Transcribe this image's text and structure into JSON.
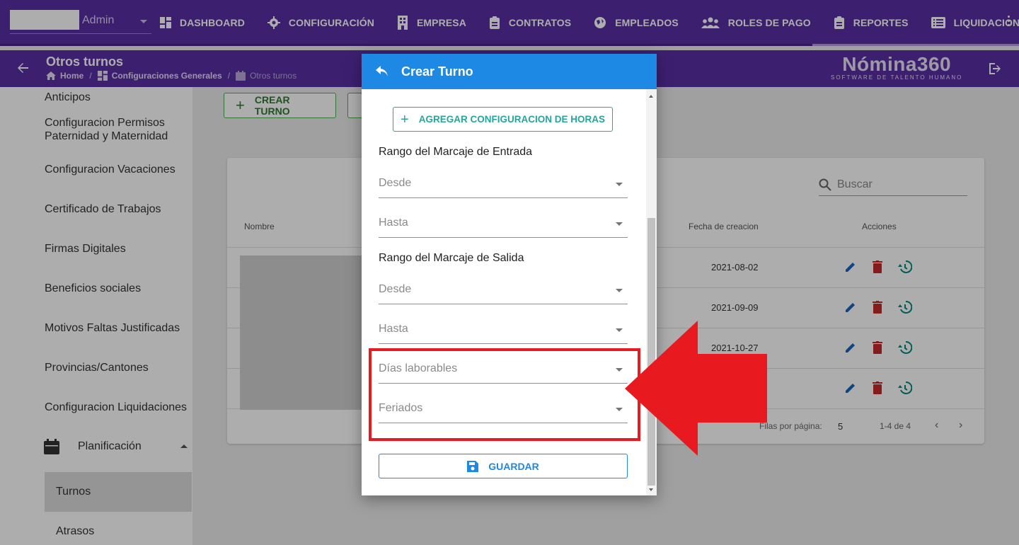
{
  "topnav": {
    "user_name": "Admin",
    "items": [
      {
        "label": "DASHBOARD",
        "icon": "dashboard-icon"
      },
      {
        "label": "CONFIGURACIÓN",
        "icon": "gear-icon"
      },
      {
        "label": "EMPRESA",
        "icon": "building-icon"
      },
      {
        "label": "CONTRATOS",
        "icon": "clipboard-icon"
      },
      {
        "label": "EMPLEADOS",
        "icon": "globe-icon"
      },
      {
        "label": "ROLES DE PAGO",
        "icon": "people-icon"
      },
      {
        "label": "REPORTES",
        "icon": "clipboard-icon"
      },
      {
        "label": "LIQUIDACIONES",
        "icon": "list-icon"
      }
    ]
  },
  "subheader": {
    "title": "Otros turnos",
    "breadcrumb": [
      "Home",
      "Configuraciones Generales",
      "Otros turnos"
    ],
    "brand_name": "Nómina360",
    "brand_tagline": "SOFTWARE DE TALENTO HUMANO"
  },
  "sidebar": {
    "items": [
      "Anticipos",
      "Configuracion Permisos Paternidad y Maternidad",
      "Configuracion Vacaciones",
      "Certificado de Trabajos",
      "Firmas Digitales",
      "Beneficios sociales",
      "Motivos Faltas Justificadas",
      "Provincias/Cantones",
      "Configuracion Liquidaciones"
    ],
    "group_label": "Planificación",
    "sub_items": [
      "Turnos",
      "Atrasos"
    ]
  },
  "toolbar": {
    "create_label": "CREAR TURNO"
  },
  "table": {
    "search_placeholder": "Buscar",
    "headers": {
      "name": "Nombre",
      "created": "Fecha de creacion",
      "actions": "Acciones"
    },
    "rows": [
      {
        "created": "2021-08-02"
      },
      {
        "created": "2021-09-09"
      },
      {
        "created": "2021-10-27"
      },
      {
        "created": ""
      }
    ],
    "rows_per_page_label": "Filas por página:",
    "rows_per_page": "5",
    "range": "1-4 de 4"
  },
  "dialog": {
    "title": "Crear Turno",
    "add_hours_label": "AGREGAR CONFIGURACION DE HORAS",
    "entry_range_label": "Rango del Marcaje de Entrada",
    "exit_range_label": "Rango del Marcaje de Salida",
    "from_placeholder": "Desde",
    "to_placeholder": "Hasta",
    "workdays_placeholder": "Días laborables",
    "holidays_placeholder": "Feriados",
    "save_label": "GUARDAR"
  },
  "colors": {
    "nav_purple": "#5b2ea6",
    "dialog_blue": "#1e88e5",
    "teal": "#26a69a",
    "highlight_red": "#e8191f"
  }
}
